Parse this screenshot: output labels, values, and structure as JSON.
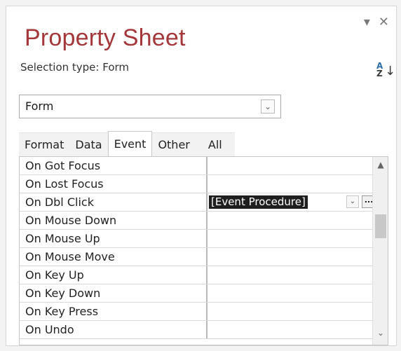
{
  "window": {
    "title": "Property Sheet",
    "minimize_icon": "▾",
    "close_icon": "✕"
  },
  "selection": {
    "label": "Selection type:",
    "value": "Form"
  },
  "sort_icon": "sort-az-icon",
  "object_combo": {
    "value": "Form",
    "dropdown_glyph": "⌄"
  },
  "tabs": [
    {
      "label": "Format",
      "active": false
    },
    {
      "label": "Data",
      "active": false
    },
    {
      "label": "Event",
      "active": true
    },
    {
      "label": "Other",
      "active": false
    },
    {
      "label": "All",
      "active": false
    }
  ],
  "properties": [
    {
      "name": "On Got Focus",
      "value": ""
    },
    {
      "name": "On Lost Focus",
      "value": ""
    },
    {
      "name": "On Dbl Click",
      "value": "[Event Procedure]"
    },
    {
      "name": "On Mouse Down",
      "value": ""
    },
    {
      "name": "On Mouse Up",
      "value": ""
    },
    {
      "name": "On Mouse Move",
      "value": ""
    },
    {
      "name": "On Key Up",
      "value": ""
    },
    {
      "name": "On Key Down",
      "value": ""
    },
    {
      "name": "On Key Press",
      "value": ""
    },
    {
      "name": "On Undo",
      "value": ""
    }
  ],
  "builder_button": "...",
  "scroll": {
    "up": "▲",
    "down": "⌄"
  },
  "colors": {
    "title": "#a4373a",
    "selected_value_bg": "#1f1f1f"
  }
}
